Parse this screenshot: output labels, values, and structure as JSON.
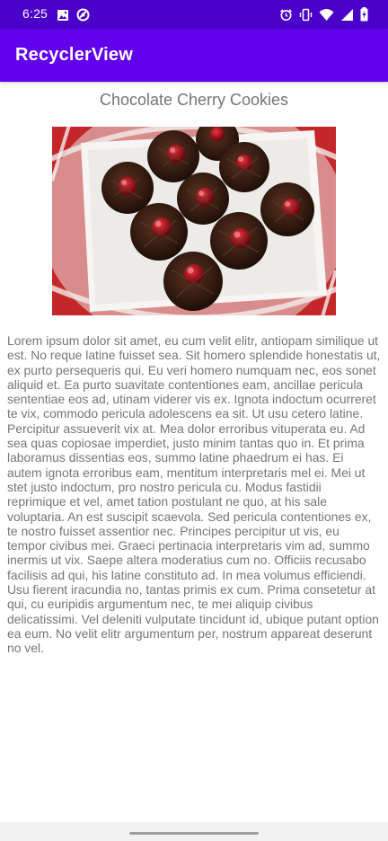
{
  "status_bar": {
    "time": "6:25",
    "left_icons": [
      "image-icon",
      "data-saver-icon"
    ],
    "right_icons": [
      "alarm-icon",
      "vibrate-icon",
      "wifi-icon",
      "signal-icon",
      "battery-charging-icon"
    ]
  },
  "app_bar": {
    "title": "RecyclerView",
    "color": "#6200ee",
    "status_color": "#4a00c8"
  },
  "item": {
    "title": "Chocolate Cherry Cookies",
    "image": "chocolate-cherry-cookies-photo",
    "body": "Lorem ipsum dolor sit amet, eu cum velit elitr, antiopam similique ut est. No reque latine fuisset sea. Sit homero splendide honestatis ut, ex purto persequeris qui. Eu veri homero numquam nec, eos sonet aliquid et. Ea purto suavitate contentiones eam, ancillae pericula sententiae eos ad, utinam viderer vis ex. Ignota indoctum ocurreret te vix, commodo pericula adolescens ea sit. Ut usu cetero latine. Percipitur assueverit vix at. Mea dolor erroribus vituperata eu. Ad sea quas copiosae imperdiet, justo minim tantas quo in. Et prima laboramus dissentias eos, summo latine phaedrum ei has. Ei autem ignota erroribus eam, mentitum interpretaris mel ei. Mei ut stet justo indoctum, pro nostro pericula cu. Modus fastidii reprimique et vel, amet tation postulant ne quo, at his sale voluptaria. An est suscipit scaevola. Sed pericula contentiones ex, te nostro fuisset assentior nec. Principes percipitur ut vis, eu tempor civibus mei. Graeci pertinacia interpretaris vim ad, summo inermis ut vix. Saepe altera moderatius cum no. Officiis recusabo facilisis ad qui, his latine constituto ad. In mea volumus efficiendi. Usu fierent iracundia no, tantas primis ex cum. Prima consetetur at qui, cu euripidis argumentum nec, te mei aliquip civibus delicatissimi. Vel deleniti vulputate tincidunt id, ubique putant option ea eum. No velit elitr argumentum per, nostrum appareat deserunt no vel."
  }
}
